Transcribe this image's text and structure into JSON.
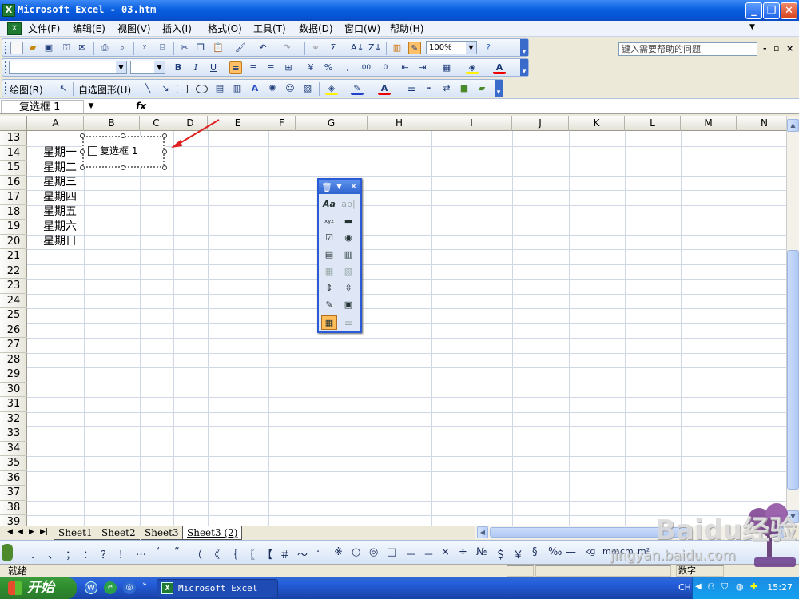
{
  "window": {
    "title": "Microsoft Excel - 03.htm",
    "app_icon": "excel-icon",
    "buttons": {
      "minimize": "_",
      "restore": "❐",
      "close": "✕"
    }
  },
  "menubar": {
    "items": [
      "文件(F)",
      "编辑(E)",
      "视图(V)",
      "插入(I)",
      "格式(O)",
      "工具(T)",
      "数据(D)",
      "窗口(W)",
      "帮助(H)"
    ],
    "help_placeholder": "键入需要帮助的问题",
    "mdi_controls": [
      "-",
      "▫",
      "×"
    ]
  },
  "standard_toolbar": {
    "zoom": "100%"
  },
  "drawing_toolbar": {
    "draw_label": "绘图(R)",
    "autoshape_label": "自选图形(U)"
  },
  "formula_bar": {
    "name_box": "复选框 1",
    "fx_label": "fx",
    "value": ""
  },
  "sheet": {
    "columns": [
      "A",
      "B",
      "C",
      "D",
      "E",
      "F",
      "G",
      "H",
      "I",
      "J",
      "K",
      "L",
      "M",
      "N"
    ],
    "rows": [
      "13",
      "14",
      "15",
      "16",
      "17",
      "18",
      "19",
      "20",
      "21",
      "22",
      "23",
      "24",
      "25",
      "26",
      "27",
      "28",
      "29",
      "30",
      "31",
      "32",
      "33",
      "34",
      "35",
      "36",
      "37",
      "38",
      "39"
    ],
    "cells_a": [
      "",
      "星期一",
      "星期二",
      "星期三",
      "星期四",
      "星期五",
      "星期六",
      "星期日"
    ],
    "checkbox_label": "复选框 1"
  },
  "forms_toolbar": {
    "buttons": [
      "Aa",
      "ab|",
      "xyz",
      "▬",
      "☑",
      "◉",
      "▤",
      "▥",
      "▦",
      "▧",
      "⇕",
      "⇳",
      "✎",
      "▣",
      "▦",
      "☰"
    ]
  },
  "sheet_tabs": [
    "Sheet1",
    "Sheet2",
    "Sheet3",
    "Sheet3 (2)"
  ],
  "symbol_bar": [
    "．",
    "、",
    "；",
    "：",
    "？",
    "！",
    "…",
    "‘",
    "“",
    "（",
    "《",
    "｛",
    "〖",
    "【",
    "＃",
    "～",
    "·",
    "※",
    "○",
    "◎",
    "□",
    "＋",
    "－",
    "×",
    "÷",
    "№",
    "＄",
    "￥",
    "§",
    "‰",
    "—",
    "kg",
    "mm",
    "cm",
    "m²"
  ],
  "statusbar": {
    "left": "就绪",
    "num": "数字"
  },
  "taskbar": {
    "start_label": "开始",
    "task_item": "Microsoft Excel ...",
    "ime": "CH",
    "clock": "15:27"
  },
  "watermark": {
    "text": "Baidu经验",
    "url": "jingyan.baidu.com"
  }
}
